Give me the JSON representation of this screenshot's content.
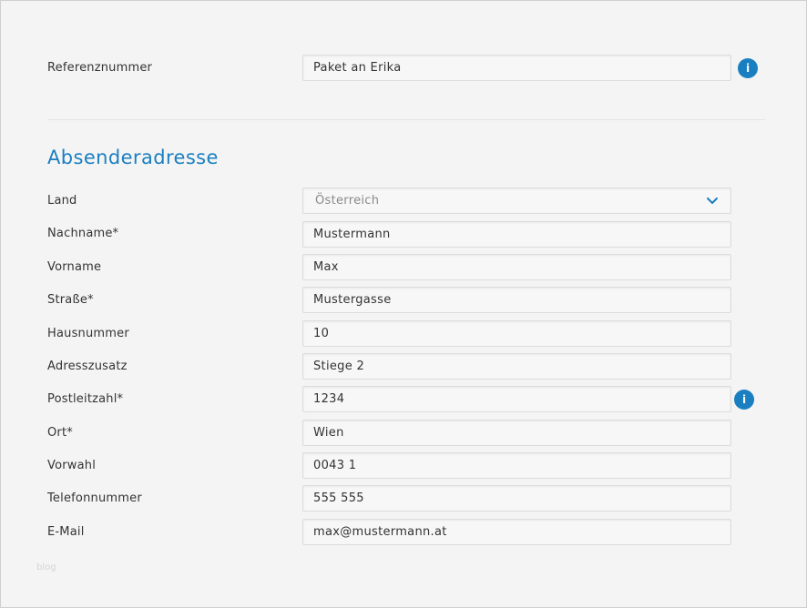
{
  "reference": {
    "label": "Referenznummer",
    "value": "Paket an Erika"
  },
  "section": {
    "title": "Absenderadresse"
  },
  "fields": [
    {
      "key": "land",
      "label": "Land",
      "value": "Österreich",
      "type": "select"
    },
    {
      "key": "nachname",
      "label": "Nachname*",
      "value": "Mustermann",
      "type": "text"
    },
    {
      "key": "vorname",
      "label": "Vorname",
      "value": "Max",
      "type": "text"
    },
    {
      "key": "strasse",
      "label": "Straße*",
      "value": "Mustergasse",
      "type": "text"
    },
    {
      "key": "hausnummer",
      "label": "Hausnummer",
      "value": "10",
      "type": "text"
    },
    {
      "key": "adresszusatz",
      "label": "Adresszusatz",
      "value": "Stiege 2",
      "type": "text"
    },
    {
      "key": "postleitzahl",
      "label": "Postleitzahl*",
      "value": "1234",
      "type": "text"
    },
    {
      "key": "ort",
      "label": "Ort*",
      "value": "Wien",
      "type": "text"
    },
    {
      "key": "vorwahl",
      "label": "Vorwahl",
      "value": "0043 1",
      "type": "text"
    },
    {
      "key": "telefonnummer",
      "label": "Telefonnummer",
      "value": "555 555",
      "type": "text"
    },
    {
      "key": "email",
      "label": "E-Mail",
      "value": "max@mustermann.at",
      "type": "text"
    }
  ],
  "icons": {
    "info": "info-icon",
    "info_glyph": "i",
    "chevron": "chevron-down-icon"
  },
  "colors": {
    "accent": "#1a7fc1",
    "background": "#f4f4f4"
  },
  "watermark": "blog"
}
